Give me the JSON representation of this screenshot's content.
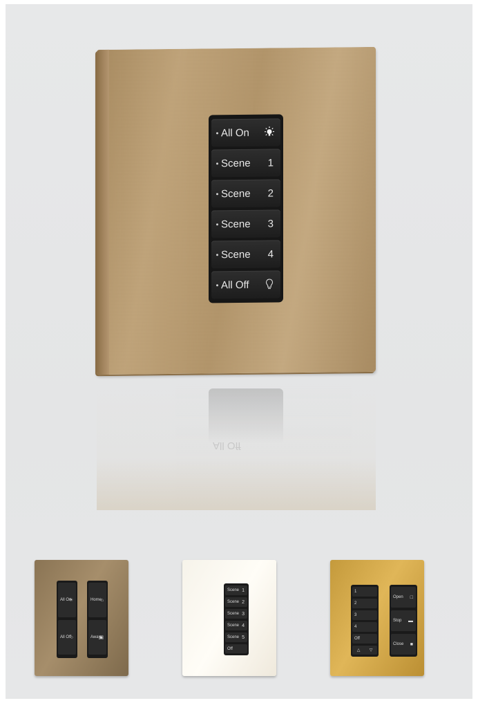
{
  "main_keypad": {
    "buttons": [
      {
        "label": "All On",
        "icon": "bulb-on-icon"
      },
      {
        "label": "Scene",
        "number": "1"
      },
      {
        "label": "Scene",
        "number": "2"
      },
      {
        "label": "Scene",
        "number": "3"
      },
      {
        "label": "Scene",
        "number": "4"
      },
      {
        "label": "All Off",
        "icon": "bulb-off-icon"
      }
    ]
  },
  "reflection_text": "All Off",
  "thumbnails": [
    {
      "finish": "bronze",
      "color": "#9a8260",
      "columns": [
        [
          "All On",
          "All Off"
        ],
        [
          "Home",
          "Away"
        ]
      ]
    },
    {
      "finish": "white",
      "color": "#fbf8f0",
      "keys": [
        {
          "label": "Scene",
          "number": "1"
        },
        {
          "label": "Scene",
          "number": "2"
        },
        {
          "label": "Scene",
          "number": "3"
        },
        {
          "label": "Scene",
          "number": "4"
        },
        {
          "label": "Scene",
          "number": "5"
        },
        {
          "label": "Off",
          "number": ""
        }
      ]
    },
    {
      "finish": "gold",
      "color": "#d4aa4c",
      "left_keys": [
        "1",
        "2",
        "3",
        "4",
        "Off"
      ],
      "right_keys": [
        "Open",
        "Stop",
        "Close"
      ]
    }
  ]
}
